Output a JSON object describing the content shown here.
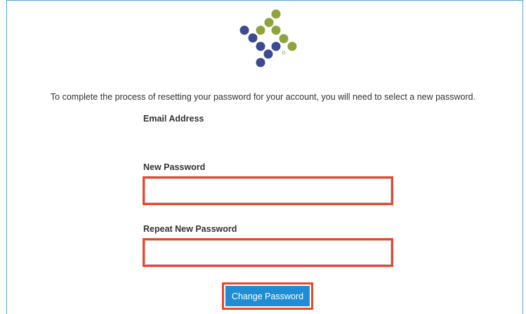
{
  "logo": {
    "icon": "company-logo-dots",
    "colors": {
      "blue": "#3b4a92",
      "green": "#8ea43c"
    }
  },
  "intro_text": "To complete the process of resetting your password for your account, you will need to select a new password.",
  "form": {
    "email_label": "Email Address",
    "email_value": "",
    "new_password_label": "New Password",
    "new_password_value": "",
    "repeat_password_label": "Repeat New Password",
    "repeat_password_value": "",
    "submit_label": "Change Password"
  },
  "colors": {
    "highlight": "#e8472b",
    "button": "#1f8dd6",
    "frame": "#5aa3d9"
  }
}
